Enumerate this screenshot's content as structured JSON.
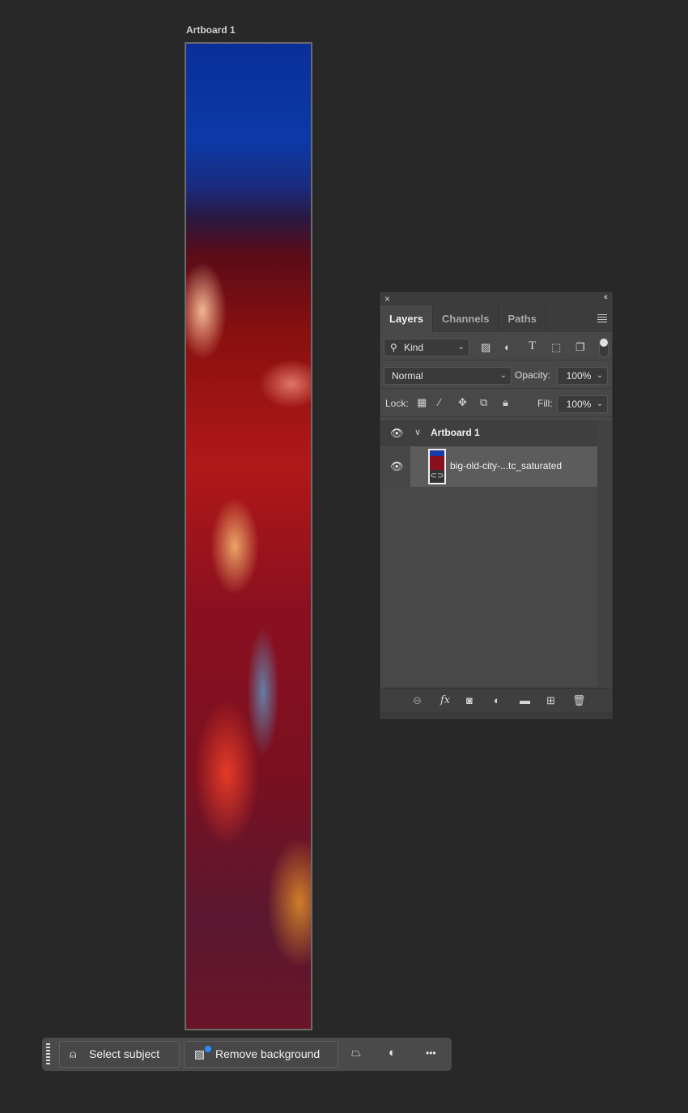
{
  "canvas": {
    "artboard_label": "Artboard 1"
  },
  "layers_panel": {
    "close_icon": "×",
    "collapse_icon": "‹‹",
    "tabs": [
      {
        "label": "Layers",
        "active": true
      },
      {
        "label": "Channels",
        "active": false
      },
      {
        "label": "Paths",
        "active": false
      }
    ],
    "filter": {
      "kind_label": "Kind",
      "filter_icons": [
        "image-filter-icon",
        "adjustment-filter-icon",
        "type-filter-icon",
        "shape-filter-icon",
        "smart-object-filter-icon"
      ]
    },
    "blend_mode": "Normal",
    "opacity_label": "Opacity:",
    "opacity_value": "100%",
    "lock_label": "Lock:",
    "fill_label": "Fill:",
    "fill_value": "100%",
    "layers": [
      {
        "name": "Artboard 1",
        "type": "artboard-group",
        "visible": true,
        "expanded": true
      },
      {
        "name": "big-old-city-...tc_saturated",
        "type": "smart-object",
        "visible": true,
        "selected": true
      }
    ],
    "bottom_icons": [
      "link-icon",
      "fx-icon",
      "mask-icon",
      "adjustment-icon",
      "folder-icon",
      "new-layer-icon",
      "trash-icon"
    ],
    "fx_label": "fx"
  },
  "contextual_taskbar": {
    "select_subject_label": "Select subject",
    "remove_background_label": "Remove background",
    "more_label": "•••"
  },
  "colors": {
    "background": "#282828",
    "panel": "#484848",
    "accent_dot": "#2d8cff"
  }
}
